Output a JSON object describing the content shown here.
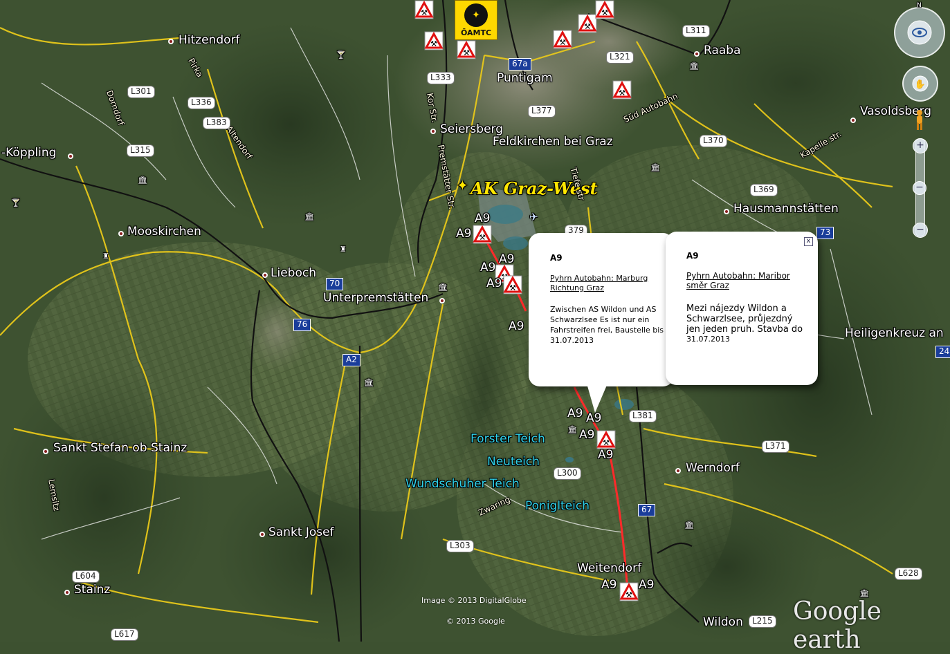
{
  "places": {
    "hitzendorf": "Hitzendorf",
    "koppling": "-Köppling",
    "mooskirchen": "Mooskirchen",
    "lieboch": "Lieboch",
    "unterpremstatten": "Unterpremstätten",
    "puntigam": "Puntigam",
    "seiersberg": "Seiersberg",
    "feldkirchen": "Feldkirchen bei Graz",
    "raaba": "Raaba",
    "vasoldsberg": "Vasoldsberg",
    "hausmannstatten": "Hausmannstätten",
    "heiligenkreuz": "Heiligenkreuz an",
    "sankt_stefan": "Sankt Stefan ob Stainz",
    "sankt_josef": "Sankt Josef",
    "stainz": "Stainz",
    "werndorf": "Werndorf",
    "weitendorf": "Weitendorf",
    "wildon": "Wildon"
  },
  "waters": {
    "forster": "Forster Teich",
    "neuteich": "Neuteich",
    "wundschuher": "Wundschuher Teich",
    "poniglteich": "Poniglteich"
  },
  "streets": {
    "pirka": "Pirka",
    "dorndorf": "Dorndorf",
    "altendorf": "Altendorf",
    "kapelle": "Kapelle str.",
    "kor": "Kor Str.",
    "premstatter": "Premstätter Str.",
    "sud_autobahn": "Süd Autobahn",
    "zwaring": "Zwaring",
    "lemsitz": "Lemsitz",
    "tiefe": "Tiefe str"
  },
  "road_shields": {
    "l311": "L311",
    "l321": "L321",
    "l333": "L333",
    "l377": "L377",
    "l370": "L370",
    "l369": "L369",
    "l301": "L301",
    "l336": "L336",
    "l383": "L383",
    "l315": "L315",
    "l379": "379",
    "l381": "L381",
    "l371": "L371",
    "l300": "L300",
    "l303": "L303",
    "l628": "L628",
    "l604": "L604",
    "l617": "L617",
    "l215": "L215"
  },
  "motorway_shields": {
    "m67a": "67a",
    "m70": "70",
    "m76": "76",
    "a2": "A2",
    "m73": "73",
    "m67": "67",
    "m24": "24"
  },
  "a9_label": "A9",
  "ak_graz_west": "AK Graz-West",
  "oamtc": "ÖAMTC",
  "balloon_de": {
    "title": "A9",
    "link_line1": "Pyhrn Autobahn: Marburg",
    "link_line2": "Richtung Graz",
    "body_line1": "Zwischen AS Wildon und AS",
    "body_line2": "Schwarzlsee Es ist nur ein",
    "body_line3": "Fahrstreifen frei, Baustelle bis",
    "body_line4": "31.07.2013"
  },
  "balloon_cs": {
    "title": "A9",
    "link_line1": "Pyhrn Autobahn: Maribor",
    "link_line2": "směr Graz",
    "body_line1": "Mezi nájezdy Wildon a",
    "body_line2": "Schwarzlsee, průjezdný",
    "body_line3": "jen jeden pruh. Stavba do",
    "body_line4": "31.07.2013",
    "close": "x"
  },
  "credits": {
    "image": "Image © 2013 DigitalGlobe",
    "copyright": "© 2013 Google",
    "logo": "Google earth"
  },
  "nav": {
    "north": "N",
    "zoom_in": "+",
    "zoom_out": "−"
  },
  "colors": {
    "road_yellow": "#e8c81a",
    "road_white": "#f2f2f2",
    "rail_black": "#111111",
    "closure_red": "#ff2a2a",
    "akgraz_yellow": "#ffe600",
    "water_cyan": "#2fd0e8"
  }
}
